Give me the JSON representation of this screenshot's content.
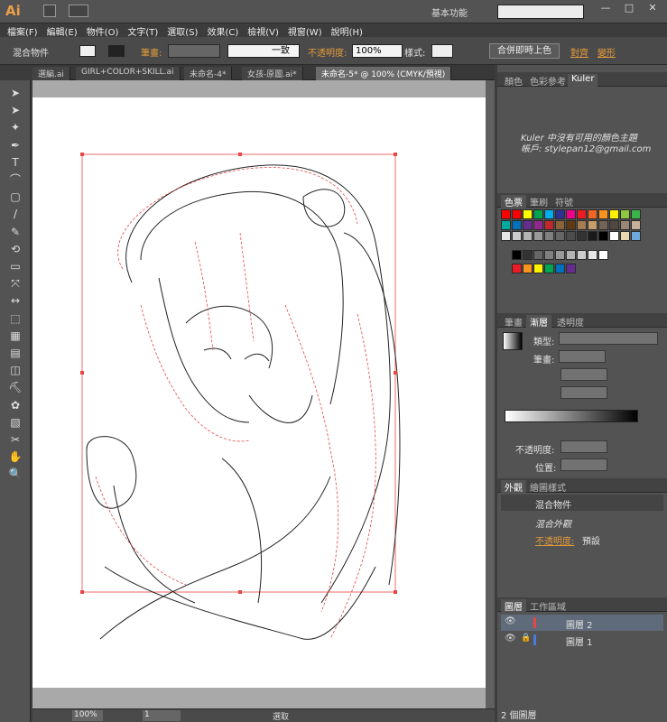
{
  "app": {
    "logo": "Ai",
    "workspace": "基本功能",
    "window_controls": [
      "—",
      "□",
      "✕"
    ]
  },
  "menu": [
    "檔案(F)",
    "編輯(E)",
    "物件(O)",
    "文字(T)",
    "選取(S)",
    "效果(C)",
    "檢視(V)",
    "視窗(W)",
    "說明(H)"
  ],
  "control": {
    "selection": "混合物件",
    "stroke_label": "筆畫:",
    "profile": "一致",
    "opacity_label": "不透明度:",
    "opacity": "100%",
    "style_label": "樣式:",
    "merge": "合併即時上色",
    "align": "對齊",
    "transform": "變形"
  },
  "tabs": [
    "選編.ai",
    "GIRL+COLOR+SKILL.ai",
    "未命名-4*",
    "女孩-原圖.ai*",
    "未命名-5* @ 100% (CMYK/預視)"
  ],
  "status": {
    "zoom": "100%",
    "page": "1",
    "mode": "選取"
  },
  "panels": {
    "color_tabs": [
      "顏色",
      "色彩參考",
      "Kuler"
    ],
    "kuler": {
      "line1": "Kuler 中沒有可用的顏色主題",
      "line2": "帳戶: stylepan12@gmail.com"
    },
    "swatch_tabs": [
      "色票",
      "筆刷",
      "符號"
    ],
    "gradient_tabs": [
      "筆畫",
      "漸層",
      "透明度"
    ],
    "gradient": {
      "type_label": "類型:",
      "stroke_label": "筆畫:",
      "opacity_label": "不透明度:",
      "position_label": "位置:"
    },
    "appearance_tabs": [
      "外觀",
      "繪圖樣式"
    ],
    "appearance": {
      "title": "混合物件",
      "item": "混合外觀",
      "opacity_label": "不透明度:",
      "opacity_val": "預設"
    },
    "layers_tabs": [
      "圖層",
      "工作區域"
    ],
    "layers": [
      {
        "name": "圖層 2",
        "color": "#e84545"
      },
      {
        "name": "圖層 1",
        "color": "#4a7cd8"
      }
    ],
    "layers_count": "2 個圖層"
  },
  "swatches": {
    "row1": [
      "#ff0000",
      "#ff0000",
      "#ffff00",
      "#00a651",
      "#00aeef",
      "#2e3192",
      "#ec008c",
      "#ed1c24",
      "#f26522",
      "#f7941d",
      "#fff200",
      "#8dc63f",
      "#39b54a"
    ],
    "row2": [
      "#00a99d",
      "#0072bc",
      "#662d91",
      "#92278f",
      "#c1272d",
      "#8c6239",
      "#603913",
      "#a67c52",
      "#c69c6d",
      "#736357",
      "#534741",
      "#998675",
      "#c7b299"
    ],
    "row3": [
      "#e6e6e6",
      "#cccccc",
      "#b3b3b3",
      "#999999",
      "#808080",
      "#666666",
      "#4d4d4d",
      "#333333",
      "#1a1a1a",
      "#000000",
      "#ffffff",
      "#e8d8b0",
      "#6fa8dc"
    ],
    "row4": [
      "#000000",
      "#333333",
      "#666666",
      "#808080",
      "#999999",
      "#b3b3b3",
      "#cccccc",
      "#e6e6e6",
      "#ffffff"
    ],
    "row5": [
      "#ed1c24",
      "#f7941d",
      "#fff200",
      "#00a651",
      "#0072bc",
      "#662d91"
    ]
  }
}
